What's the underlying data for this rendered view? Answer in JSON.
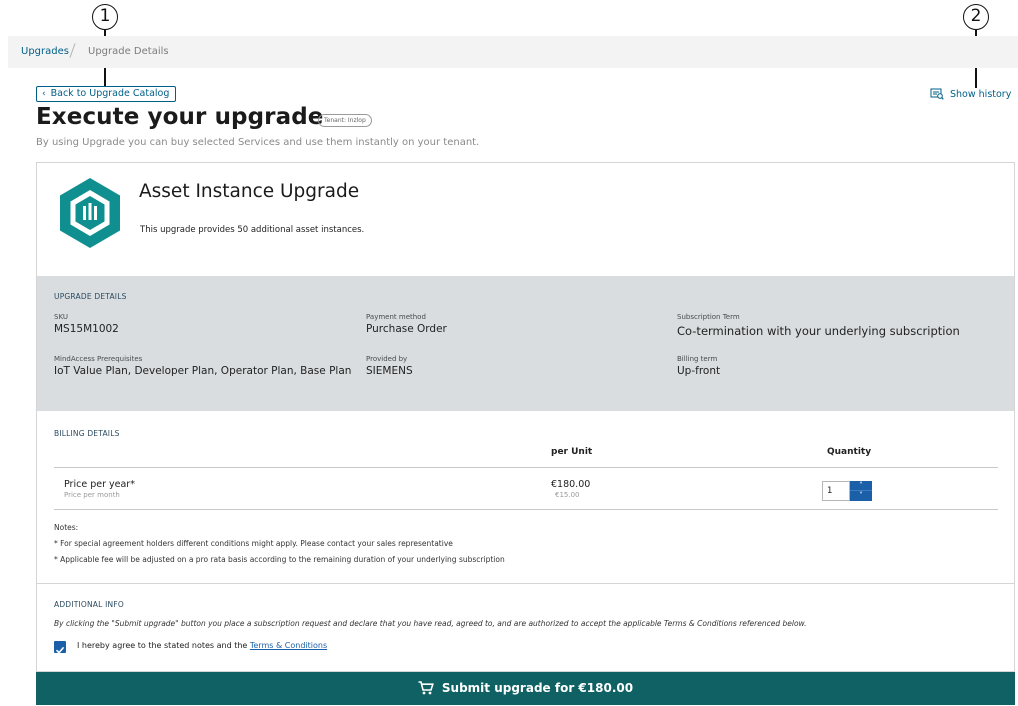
{
  "callouts": [
    "1",
    "2"
  ],
  "breadcrumb": {
    "root": "Upgrades",
    "current": "Upgrade Details"
  },
  "back_label": "Back to Upgrade Catalog",
  "history_label": "Show history",
  "page": {
    "title": "Execute your upgrade",
    "tenant_badge": "Tenant: Inzlop",
    "subtitle": "By using Upgrade you can buy selected Services and use them instantly on your tenant."
  },
  "product": {
    "name": "Asset Instance Upgrade",
    "description": "This upgrade provides 50 additional asset instances.",
    "logo_icon": "hexagon-bars-icon",
    "logo_color": "#0f8f8f"
  },
  "upgrade_details": {
    "heading": "UPGRADE DETAILS",
    "sku_label": "SKU",
    "sku": "MS15M1002",
    "payment_label": "Payment method",
    "payment": "Purchase Order",
    "term_label": "Subscription Term",
    "term": "Co-termination with your underlying subscription",
    "prereq_label": "MindAccess Prerequisites",
    "prereq": "IoT Value Plan, Developer Plan, Operator Plan, Base Plan",
    "provider_label": "Provided by",
    "provider": "SIEMENS",
    "billing_term_label": "Billing term",
    "billing_term": "Up-front"
  },
  "billing": {
    "heading": "BILLING DETAILS",
    "col_per_unit": "per Unit",
    "col_quantity": "Quantity",
    "row_label": "Price per year*",
    "row_sublabel": "Price per month",
    "price_year": "€180.00",
    "price_month": "€15.00",
    "quantity": "1",
    "notes_title": "Notes:",
    "note1": "* For special agreement holders different conditions might apply. Please contact your sales representative",
    "note2": "* Applicable fee will be adjusted on a pro rata basis according to the remaining duration of your underlying subscription"
  },
  "additional": {
    "heading": "ADDITIONAL INFO",
    "legal": "By clicking the \"Submit upgrade\" button you place a subscription request and declare that you have read, agreed to, and are authorized to accept the applicable Terms & Conditions referenced below.",
    "agree_text": "I hereby agree to the stated notes and the ",
    "terms_link": "Terms & Conditions",
    "agreed": true
  },
  "submit_label": "Submit upgrade for €180.00",
  "colors": {
    "accent": "#005f87",
    "submit": "#0f6164",
    "stepper": "#1a5fa8",
    "details_bg": "#d9dde0"
  }
}
